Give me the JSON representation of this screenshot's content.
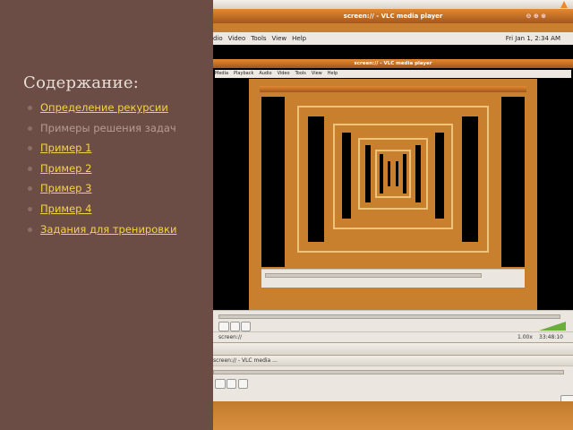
{
  "slide": {
    "toc_title": "Содержание:",
    "items": [
      {
        "label": "Определение рекурсии",
        "link": true
      },
      {
        "label": "Примеры решения задач",
        "link": false
      },
      {
        "label": "Пример 1",
        "link": true
      },
      {
        "label": "Пример 2",
        "link": true
      },
      {
        "label": "Пример 3",
        "link": true
      },
      {
        "label": "Пример 4",
        "link": true
      },
      {
        "label": "Задания для тренировки",
        "link": true
      }
    ]
  },
  "vlc": {
    "window_title": "screen:// - VLC media player",
    "menu": [
      "dio",
      "Video",
      "Tools",
      "View",
      "Help"
    ],
    "inner_menu": [
      "Media",
      "Playback",
      "Audio",
      "Video",
      "Tools",
      "View",
      "Help"
    ],
    "clock": "Fri Jan 1,  2:34 AM",
    "status_source": "screen://",
    "speed": "1.00x",
    "time": "33:48:10",
    "task_item": "screen:// - VLC media ..."
  },
  "colors": {
    "slide_bg": "#6b4d46",
    "link": "#f6d24a",
    "muted": "#b59c93",
    "accent_orange": "#d4892e"
  },
  "icons": [
    "bullet-icon",
    "vlc-cone-icon",
    "play-pause-icon",
    "stop-icon",
    "playlist-icon",
    "volume-icon",
    "network-icon",
    "speaker-icon"
  ]
}
